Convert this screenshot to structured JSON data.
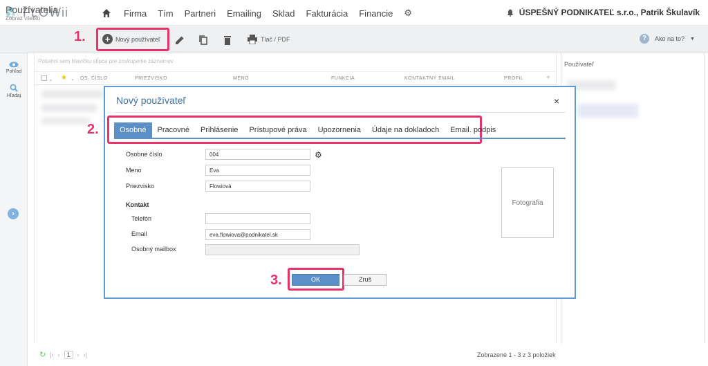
{
  "app": {
    "logo_text": "FLOWii"
  },
  "nav": {
    "items": [
      "Firma",
      "Tím",
      "Partneri",
      "Emailing",
      "Sklad",
      "Fakturácia",
      "Financie"
    ],
    "company": "ÚSPEŠNÝ PODNIKATEĽ s.r.o., Patrik Škulavík"
  },
  "toolbar": {
    "title": "Používatelia",
    "subtitle": "Zobraz všetko",
    "new_user_label": "Nový používateľ",
    "print_label": "Tlač / PDF",
    "help_label": "Ako na to?"
  },
  "sidebar": {
    "view_label": "Pohľad",
    "search_label": "Hľadaj"
  },
  "table": {
    "group_hint": "Potiahni sem hlavičku stĺpca pre zoskupenie záznamov",
    "columns": [
      "OS. ČÍSLO",
      "PRIEZVISKO",
      "MENO",
      "FUNKCIA",
      "KONTAKTNÝ EMAIL",
      "PROFIL"
    ]
  },
  "right_panel": {
    "title": "Používateľ"
  },
  "footer": {
    "page": "1",
    "count_text": "Zobrazené 1 - 3 z 3 položiek"
  },
  "modal": {
    "title": "Nový používateľ",
    "close": "×",
    "tabs": [
      "Osobné",
      "Pracovné",
      "Prihlásenie",
      "Prístupové práva",
      "Upozornenia",
      "Údaje na dokladoch",
      "Email. podpis"
    ],
    "fields": {
      "personal_number_label": "Osobné číslo",
      "personal_number_value": "004",
      "first_name_label": "Meno",
      "first_name_value": "Eva",
      "last_name_label": "Priezvisko",
      "last_name_value": "Flowiová",
      "contact_heading": "Kontakt",
      "phone_label": "Telefón",
      "phone_value": "",
      "email_label": "Email",
      "email_value": "eva.flowiova@podnikatel.sk",
      "mailbox_label": "Osobný mailbox",
      "mailbox_value": ""
    },
    "photo_label": "Fotografia",
    "ok_label": "OK",
    "cancel_label": "Zruš"
  },
  "annotations": {
    "step1": "1.",
    "step2": "2.",
    "step3": "3.",
    "color": "#e8336a"
  },
  "colors": {
    "accent": "#5b8fc7",
    "highlight": "#e8336a"
  }
}
